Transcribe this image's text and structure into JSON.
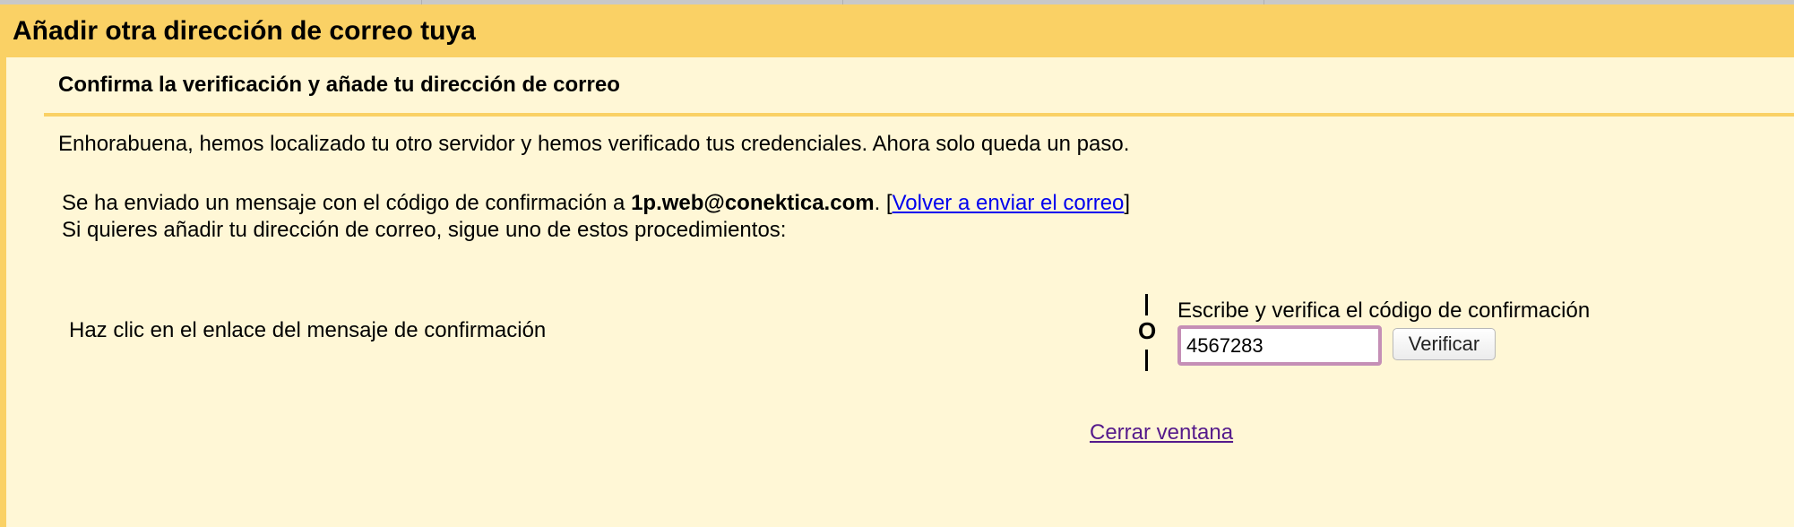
{
  "dialog": {
    "title": "Añadir otra dirección de correo tuya",
    "subtitle": "Confirma la verificación y añade tu dirección de correo",
    "success_message": "Enhorabuena, hemos localizado tu otro servidor y hemos verificado tus credenciales. Ahora solo queda un paso.",
    "sent_prefix": "Se ha enviado un mensaje con el código de confirmación a ",
    "email": "1p.web@conektica.com",
    "sent_suffix": ". [",
    "resend_link": "Volver a enviar el correo",
    "sent_close": "]",
    "instructions": "Si quieres añadir tu dirección de correo, sigue uno de estos procedimientos:",
    "option_link": "Haz clic en el enlace del mensaje de confirmación",
    "or_label": "O",
    "option_code": "Escribe y verifica el código de confirmación",
    "code_value": "4567283",
    "verify_button": "Verificar",
    "close_link": "Cerrar ventana"
  },
  "colors": {
    "header_bg": "#fad165",
    "body_bg": "#fff7d6",
    "link": "#0000ee",
    "visited_link": "#551a8b",
    "input_focus_border": "#c58fb6"
  }
}
